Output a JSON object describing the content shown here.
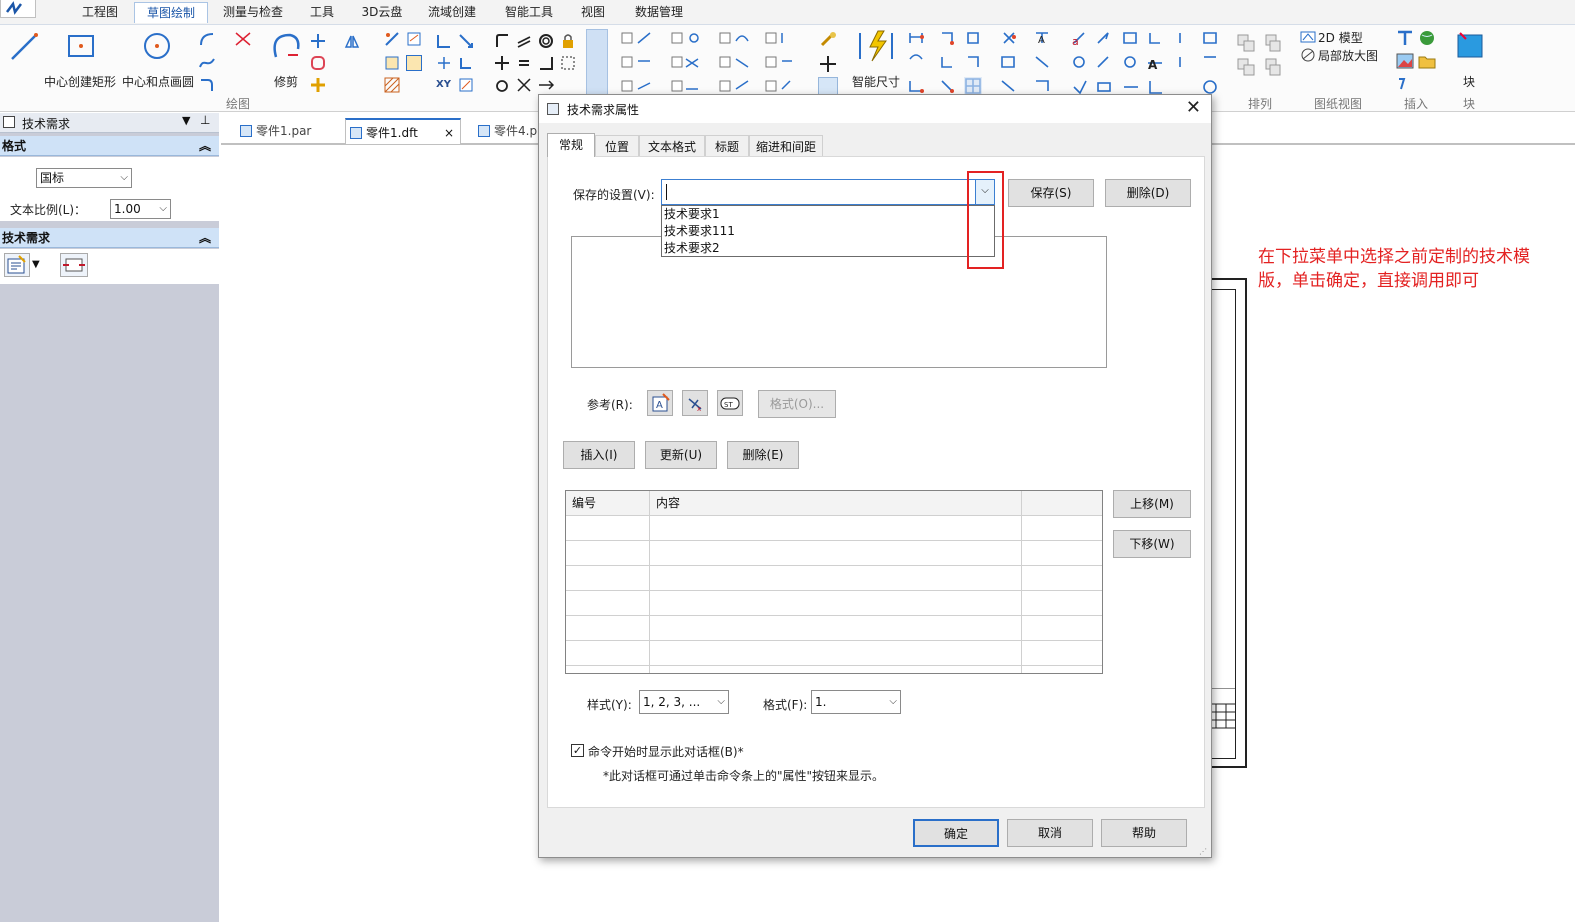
{
  "ribbon_tabs": [
    "工程图",
    "草图绘制",
    "测量与检查",
    "工具",
    "3D云盘",
    "流域创建",
    "智能工具",
    "视图",
    "数据管理"
  ],
  "active_tab": "草图绘制",
  "ribbon": {
    "tool_labels": {
      "center_rect": "中心创建矩形",
      "center_circle": "中心和点画圆",
      "trim": "修剪",
      "smart_dimension": "智能尺寸",
      "model_2d": "2D 模型",
      "detail_view": "局部放大图",
      "block": "块"
    },
    "group_labels": {
      "draw": "绘图",
      "arrange": "排列",
      "drawing_views": "图纸视图",
      "insert": "插入",
      "block": "块"
    },
    "xy_icon_text": "XY"
  },
  "left_panel": {
    "title": "技术需求",
    "format_section": "格式",
    "standard_value": "国标",
    "text_scale_label": "文本比例(L)：",
    "text_scale_value": "1.00",
    "tech_section": "技术需求"
  },
  "doc_tabs": [
    "零件1.par",
    "零件1.dft",
    "零件4.p"
  ],
  "active_doc_tab": "零件1.dft",
  "annotation": "在下拉菜单中选择之前定制的技术模版，单击确定，直接调用即可",
  "colors": {
    "accent": "#1b56a8",
    "annotation_red": "#e32222",
    "section_header": "#cfe2f7"
  },
  "dialog": {
    "title": "技术需求属性",
    "tabs": [
      "常规",
      "位置",
      "文本格式",
      "标题",
      "缩进和间距"
    ],
    "active_tab": "常规",
    "saved_settings_label": "保存的设置(V):",
    "saved_settings_value": "",
    "dropdown_options": [
      "技术要求1",
      "技术要求111",
      "技术要求2"
    ],
    "save_btn": "保存(S)",
    "delete_btn": "删除(D)",
    "reference_label": "参考(R):",
    "format_btn": "格式(O)...",
    "insert_btn": "插入(I)",
    "update_btn": "更新(U)",
    "delete_entry_btn": "删除(E)",
    "table_headers": [
      "编号",
      "内容",
      ""
    ],
    "move_up_btn": "上移(M)",
    "move_down_btn": "下移(W)",
    "style_label": "样式(Y):",
    "style_value": "1, 2, 3, ...",
    "format_label": "格式(F):",
    "format_value": "1.",
    "show_dialog_label": "命令开始时显示此对话框(B)*",
    "show_dialog_checked": true,
    "footnote": "*此对话框可通过单击命令条上的\"属性\"按钮来显示。",
    "ok_btn": "确定",
    "cancel_btn": "取消",
    "help_btn": "帮助",
    "reference_icons": [
      "insert-field-icon",
      "insert-symbol-icon",
      "insert-st-icon"
    ],
    "reference_icon_text": {
      "st": "ST",
      "x": "x"
    }
  }
}
